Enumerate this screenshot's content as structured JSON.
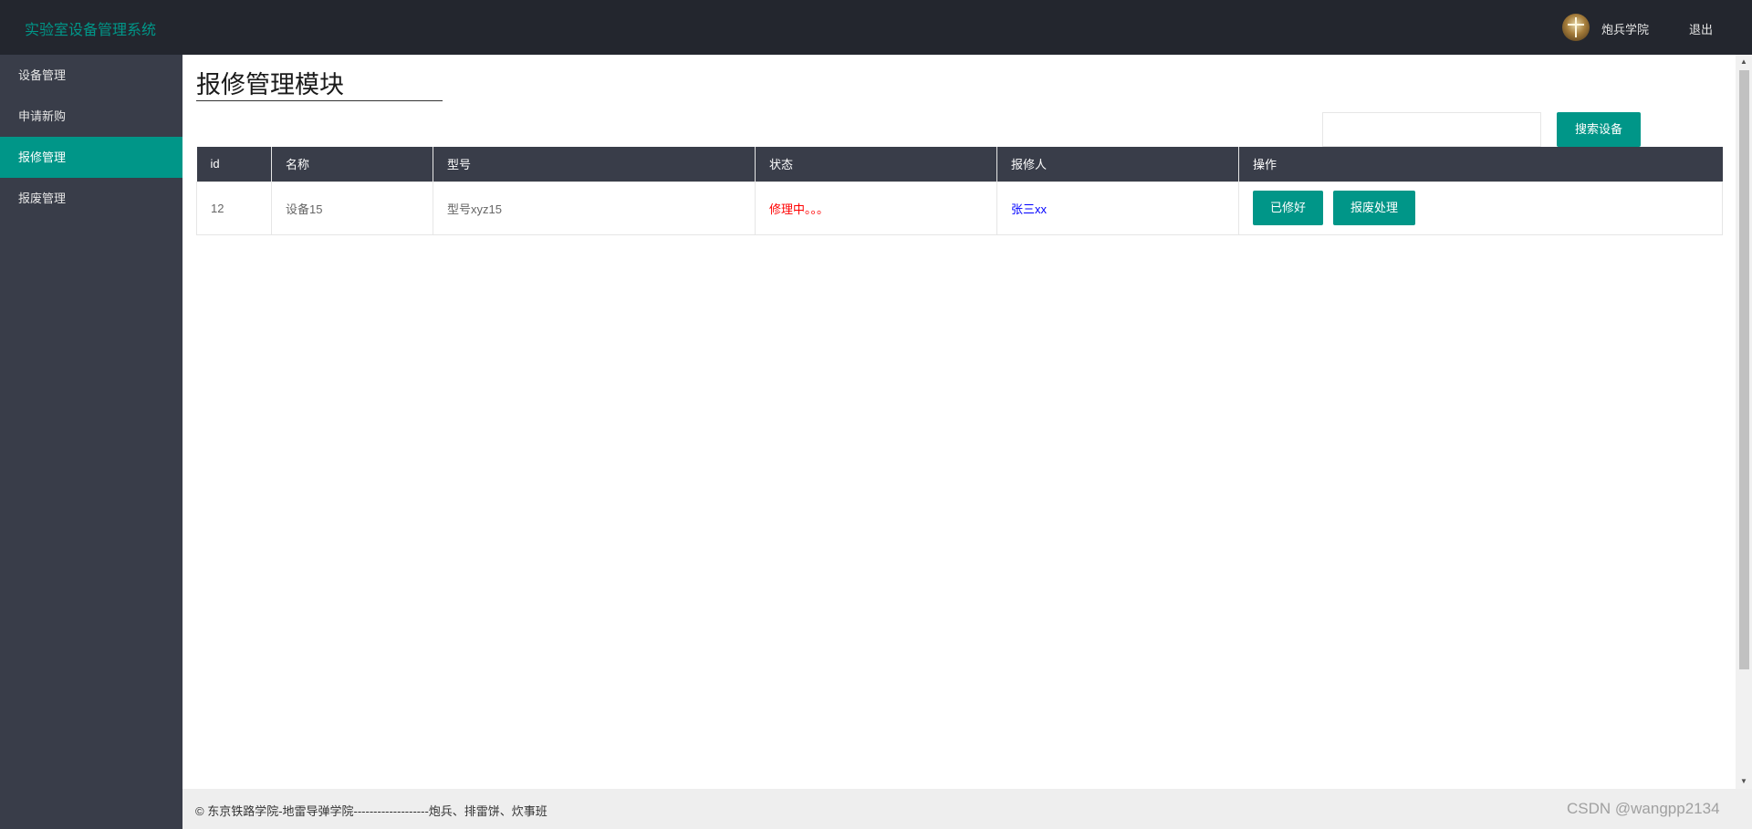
{
  "header": {
    "logo": "实验室设备管理系统",
    "user_name": "炮兵学院",
    "logout": "退出"
  },
  "sidebar": {
    "items": [
      {
        "label": "设备管理",
        "active": false
      },
      {
        "label": "申请新购",
        "active": false
      },
      {
        "label": "报修管理",
        "active": true
      },
      {
        "label": "报废管理",
        "active": false
      }
    ]
  },
  "main": {
    "title": "报修管理模块",
    "search": {
      "placeholder": "",
      "button": "搜索设备"
    },
    "table": {
      "columns": [
        "id",
        "名称",
        "型号",
        "状态",
        "报修人",
        "操作"
      ],
      "rows": [
        {
          "id": "12",
          "name": "设备15",
          "model": "型号xyz15",
          "status": "修理中。。。",
          "reporter": "张三xx",
          "actions": [
            "已修好",
            "报废处理"
          ]
        }
      ]
    }
  },
  "footer": {
    "text": "© 东京铁路学院-地雷导弹学院-------------------炮兵、排雷饼、炊事班",
    "watermark": "CSDN @wangpp2134"
  },
  "colors": {
    "accent": "#009688",
    "header_bg": "#23262e",
    "sidebar_bg": "#393d49",
    "status_red": "#ff0000",
    "reporter_blue": "#0000ff"
  }
}
